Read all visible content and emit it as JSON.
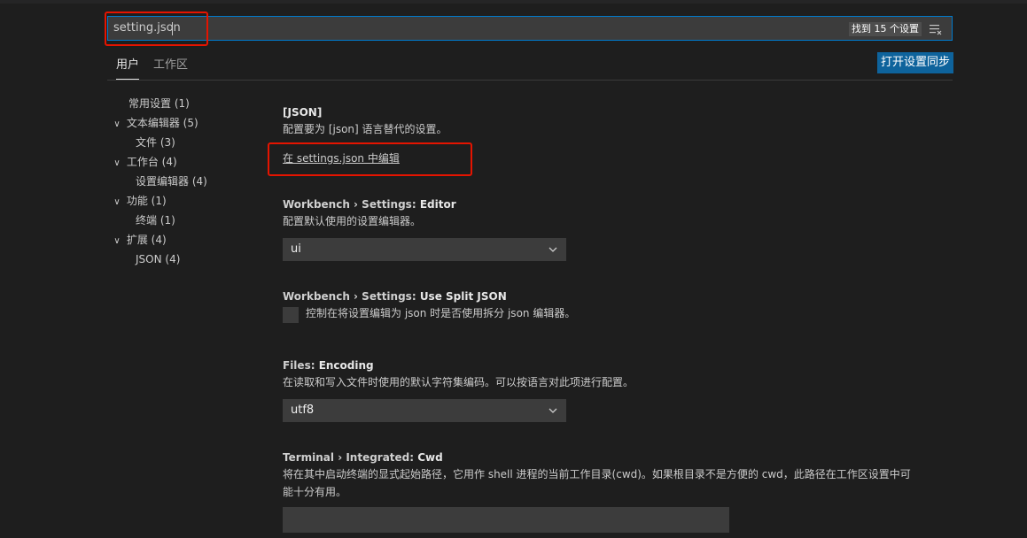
{
  "search": {
    "value": "setting.json",
    "found_label": "找到 15 个设置"
  },
  "tabs": [
    {
      "label": "用户"
    },
    {
      "label": "工作区"
    }
  ],
  "sync_button_label": "打开设置同步",
  "toc": [
    {
      "label": "常用设置 (1)",
      "expanded": null
    },
    {
      "label": "文本编辑器 (5)",
      "expanded": true
    },
    {
      "label": "文件 (3)",
      "expanded": null
    },
    {
      "label": "工作台 (4)",
      "expanded": true
    },
    {
      "label": "设置编辑器 (4)",
      "expanded": null
    },
    {
      "label": "功能 (1)",
      "expanded": true
    },
    {
      "label": "终端 (1)",
      "expanded": null
    },
    {
      "label": "扩展 (4)",
      "expanded": true
    },
    {
      "label": "JSON (4)",
      "expanded": null
    }
  ],
  "settings": {
    "json": {
      "title": "[JSON]",
      "description": "配置要为 [json] 语言替代的设置。",
      "link": "在 settings.json 中编辑"
    },
    "editor": {
      "category": "Workbench › Settings: ",
      "name": "Editor",
      "description": "配置默认使用的设置编辑器。",
      "value": "ui"
    },
    "split_json": {
      "category": "Workbench › Settings: ",
      "name": "Use Split JSON",
      "description": "控制在将设置编辑为 json 时是否使用拆分 json 编辑器。",
      "checked": false
    },
    "encoding": {
      "category": "Files: ",
      "name": "Encoding",
      "description": "在读取和写入文件时使用的默认字符集编码。可以按语言对此项进行配置。",
      "value": "utf8"
    },
    "cwd": {
      "category": "Terminal › Integrated: ",
      "name": "Cwd",
      "description_line1": "将在其中启动终端的显式起始路径，它用作 shell 进程的当前工作目录(cwd)。如果根目录不是方便的 cwd，此路径在工作区设置中可",
      "description_line2": "能十分有用。",
      "value": ""
    }
  },
  "colors": {
    "background": "#1e1e1e",
    "accent": "#007acc",
    "button": "#0e639c",
    "highlight_box": "#e51400"
  }
}
